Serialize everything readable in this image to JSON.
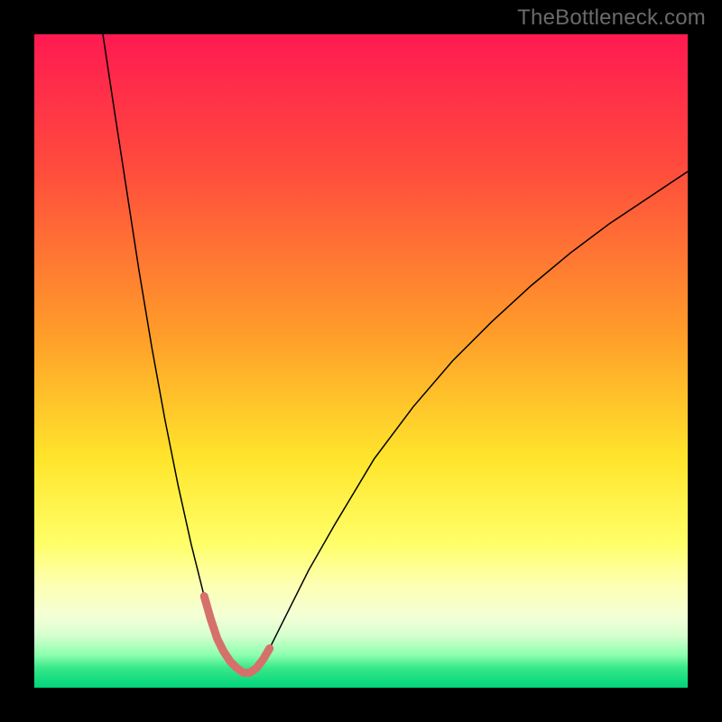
{
  "watermark": "TheBottleneck.com",
  "chart_data": {
    "type": "line",
    "title": "",
    "xlabel": "",
    "ylabel": "",
    "xlim": [
      0,
      100
    ],
    "ylim": [
      0,
      100
    ],
    "gradient_stops": [
      {
        "offset": 0,
        "color": "#ff1a52"
      },
      {
        "offset": 20,
        "color": "#ff4a3d"
      },
      {
        "offset": 45,
        "color": "#ff9a2a"
      },
      {
        "offset": 65,
        "color": "#ffe52b"
      },
      {
        "offset": 78,
        "color": "#ffff69"
      },
      {
        "offset": 84,
        "color": "#fdffb0"
      },
      {
        "offset": 89,
        "color": "#f4ffd6"
      },
      {
        "offset": 92,
        "color": "#d6ffcf"
      },
      {
        "offset": 95,
        "color": "#8cffad"
      },
      {
        "offset": 97,
        "color": "#37e889"
      },
      {
        "offset": 100,
        "color": "#00d47a"
      }
    ],
    "series": [
      {
        "name": "bottleneck-curve",
        "stroke": "#000000",
        "stroke_width": 1.5,
        "x": [
          10.5,
          12,
          14,
          16,
          18,
          20,
          22,
          24,
          25,
          26,
          27,
          28,
          29,
          30,
          31,
          32,
          33,
          34,
          35,
          36,
          38,
          42,
          46,
          52,
          58,
          64,
          70,
          76,
          82,
          88,
          94,
          100
        ],
        "values": [
          100,
          90,
          77,
          64,
          52,
          41,
          31,
          22,
          18,
          14,
          10.5,
          7.5,
          5.5,
          4,
          3,
          2.3,
          2.3,
          3,
          4.3,
          6,
          10,
          18,
          25,
          35,
          43,
          50,
          56,
          61.5,
          66.5,
          71,
          75,
          79
        ]
      },
      {
        "name": "highlight-trough",
        "stroke": "#d6706b",
        "stroke_width": 9,
        "linecap": "round",
        "x": [
          26,
          27,
          28,
          29,
          30,
          31,
          32,
          33,
          34,
          35,
          36
        ],
        "values": [
          14,
          10.5,
          7.5,
          5.5,
          4,
          3,
          2.3,
          2.3,
          3,
          4.3,
          6
        ]
      }
    ]
  }
}
